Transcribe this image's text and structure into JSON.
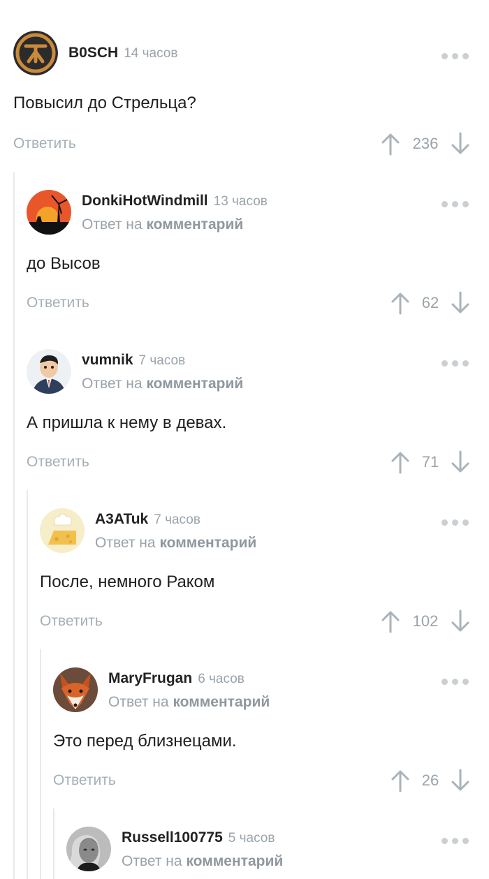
{
  "reply_label": "Ответить",
  "reply_to_prefix": "Ответ на",
  "reply_to_link": "комментарий",
  "colors": {
    "muted": "#9aa3aa",
    "action": "#a3b0b6",
    "thread_line": "#e6e9ec"
  },
  "comments": [
    {
      "author": "B0SCH",
      "time": "14 часов",
      "text": "Повысил до Стрельца?",
      "rating": "236",
      "avatar": "bosch-logo"
    },
    {
      "author": "DonkiHotWindmill",
      "time": "13 часов",
      "text": "до Высов",
      "rating": "62",
      "avatar": "windmill-sunset"
    },
    {
      "author": "vumnik",
      "time": "7 часов",
      "text": "А пришла к нему в девах.",
      "rating": "71",
      "avatar": "cartoon-man"
    },
    {
      "author": "A3ATuk",
      "time": "7 часов",
      "text": "После, немного Раком",
      "rating": "102",
      "avatar": "cheese-chef"
    },
    {
      "author": "MaryFrugan",
      "time": "6 часов",
      "text": "Это перед близнецами.",
      "rating": "26",
      "avatar": "fox"
    },
    {
      "author": "Russell100775",
      "time": "5 часов",
      "avatar": "man-photo"
    }
  ]
}
